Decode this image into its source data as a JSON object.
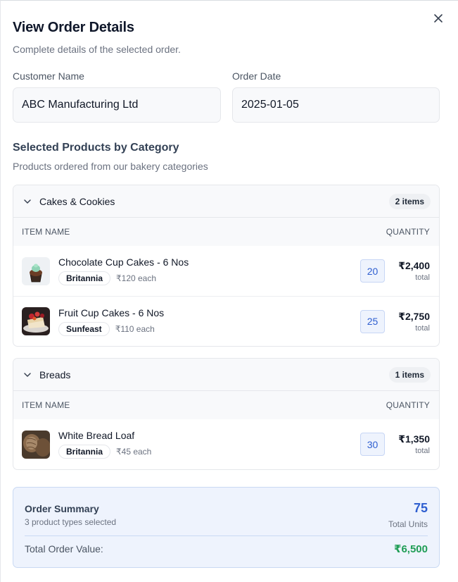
{
  "dialog": {
    "title": "View Order Details",
    "subtitle": "Complete details of the selected order."
  },
  "fields": {
    "customer_label": "Customer Name",
    "customer_value": "ABC Manufacturing Ltd",
    "date_label": "Order Date",
    "date_value": "2025-01-05"
  },
  "products": {
    "title": "Selected Products by Category",
    "subtitle": "Products ordered from our bakery categories",
    "col_item": "ITEM NAME",
    "col_qty": "QUANTITY",
    "categories": [
      {
        "name": "Cakes & Cookies",
        "badge": "2 items",
        "items": [
          {
            "name": "Chocolate Cup Cakes - 6 Nos",
            "brand": "Britannia",
            "each": "₹120 each",
            "qty": "20",
            "total": "₹2,400",
            "total_label": "total"
          },
          {
            "name": "Fruit Cup Cakes - 6 Nos",
            "brand": "Sunfeast",
            "each": "₹110 each",
            "qty": "25",
            "total": "₹2,750",
            "total_label": "total"
          }
        ]
      },
      {
        "name": "Breads",
        "badge": "1 items",
        "items": [
          {
            "name": "White Bread Loaf",
            "brand": "Britannia",
            "each": "₹45 each",
            "qty": "30",
            "total": "₹1,350",
            "total_label": "total"
          }
        ]
      }
    ]
  },
  "summary": {
    "title": "Order Summary",
    "subtitle": "3 product types selected",
    "units": "75",
    "units_label": "Total Units",
    "total_label": "Total Order Value:",
    "total_value": "₹6,500"
  },
  "icons": {
    "close": "close-icon",
    "chevron": "chevron-down-icon"
  },
  "colors": {
    "accent_blue": "#2f5fd0",
    "total_green": "#1f9d55"
  }
}
